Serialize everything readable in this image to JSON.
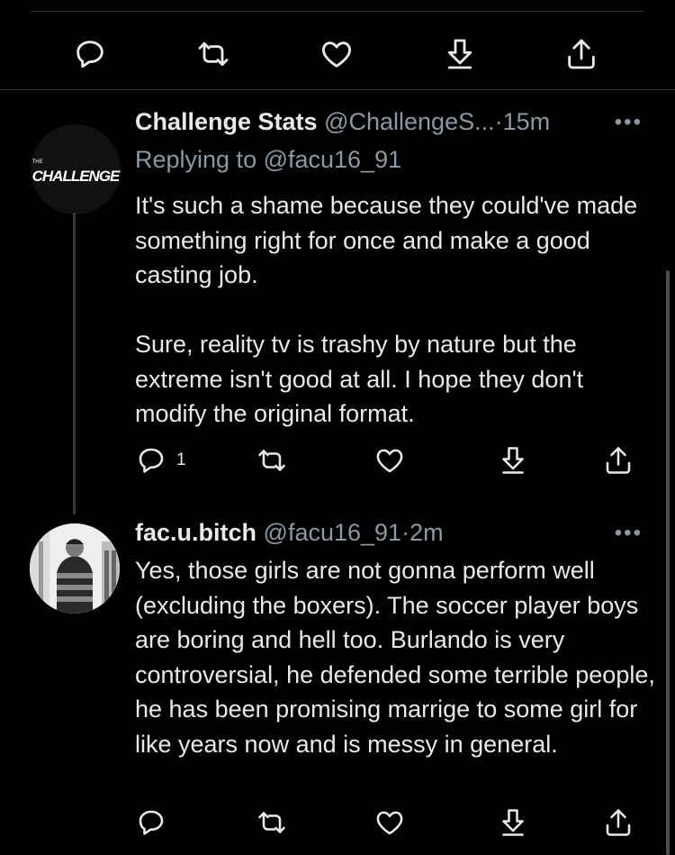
{
  "tweet1": {
    "author_name": "Challenge Stats",
    "handle": "@ChallengeS...",
    "time": "15m",
    "more": "•••",
    "replying_to": "Replying to @facu16_91",
    "avatar_text": "CHALLENGE",
    "body": "It's such a shame because they could've made something right for once and make a good casting job.\n\nSure, reality tv is trashy by nature but the extreme isn't good at all. I hope they don't modify the original format.",
    "reply_count": "1"
  },
  "tweet2": {
    "author_name": "fac.u.bitch",
    "handle": "@facu16_91",
    "time": "2m",
    "more": "•••",
    "body": "Yes, those girls are not gonna perform well (excluding the boxers). The soccer player boys are boring and hell too. Burlando is very controversial, he defended some terrible people, he has been promising marrige to some girl for like years now and is messy in general."
  },
  "separator": "·",
  "icons": [
    "reply-icon",
    "retweet-icon",
    "like-icon",
    "download-icon",
    "share-icon"
  ]
}
